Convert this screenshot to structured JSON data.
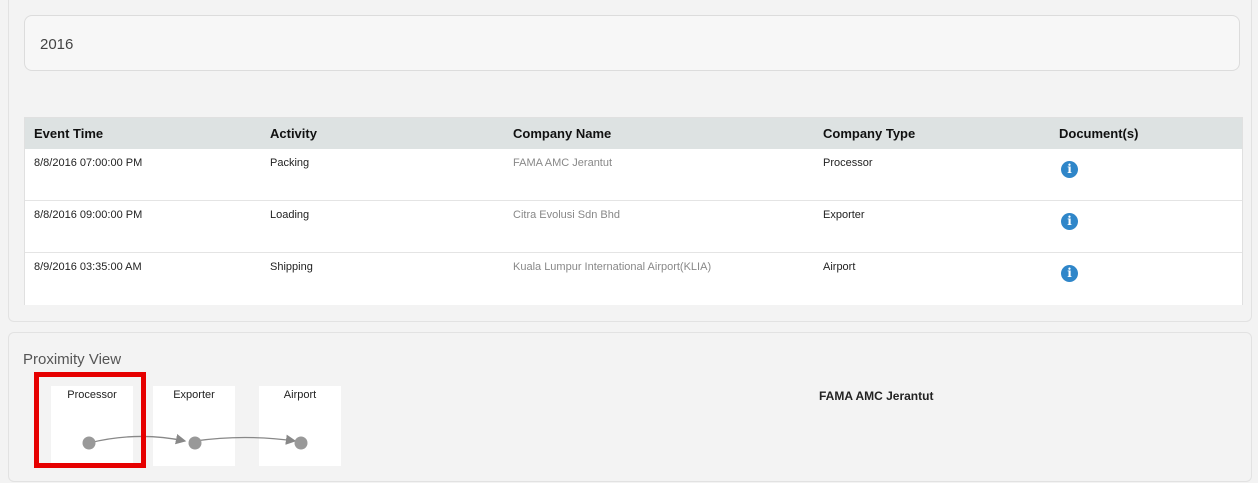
{
  "year": "2016",
  "table": {
    "headers": [
      "Event Time",
      "Activity",
      "Company Name",
      "Company Type",
      "Document(s)"
    ],
    "rows": [
      {
        "time": "8/8/2016 07:00:00 PM",
        "activity": "Packing",
        "company": "FAMA AMC Jerantut",
        "type": "Processor",
        "doc_icon": "info-icon"
      },
      {
        "time": "8/8/2016 09:00:00 PM",
        "activity": "Loading",
        "company": "Citra Evolusi Sdn Bhd",
        "type": "Exporter",
        "doc_icon": "info-icon"
      },
      {
        "time": "8/9/2016 03:35:00 AM",
        "activity": "Shipping",
        "company": "Kuala Lumpur International Airport(KLIA)",
        "type": "Airport",
        "doc_icon": "info-icon"
      }
    ],
    "info_glyph": "i"
  },
  "proximity": {
    "title": "Proximity View",
    "nodes": [
      "Processor",
      "Exporter",
      "Airport"
    ],
    "selected_node": "Processor",
    "selected_company": "FAMA AMC Jerantut"
  },
  "colors": {
    "header_bg": "#dde2e2",
    "info_icon": "#2f86c9",
    "selection_border": "#e60000",
    "node_dot": "#999999"
  }
}
